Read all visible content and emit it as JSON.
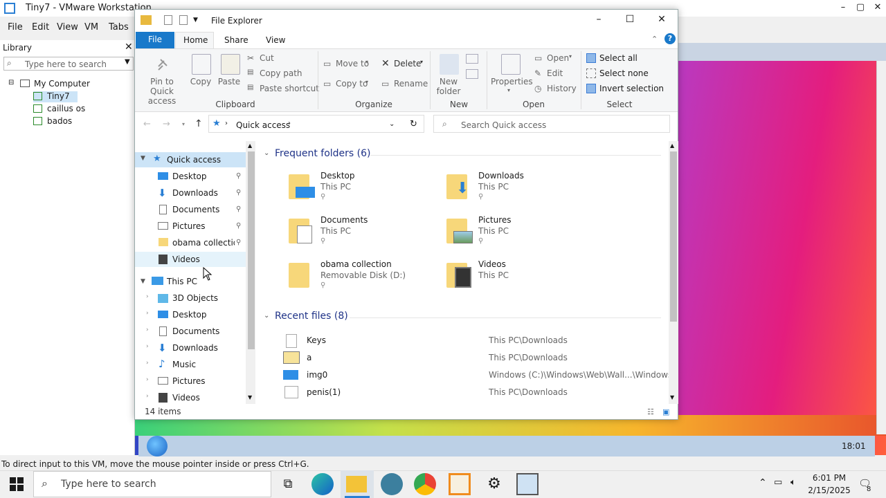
{
  "vmware": {
    "title": "Tiny7 - VMware Workstation",
    "menus": [
      "File",
      "Edit",
      "View",
      "VM",
      "Tabs"
    ],
    "library": {
      "title": "Library",
      "search_placeholder": "Type here to search",
      "tree": [
        "My Computer",
        "Tiny7",
        "caillus os",
        "bados"
      ]
    },
    "status_text": "To direct input to this VM, move the mouse pointer inside or press Ctrl+G.",
    "guest_clock": "18:01"
  },
  "explorer": {
    "title": "File Explorer",
    "tabs": [
      "File",
      "Home",
      "Share",
      "View"
    ],
    "ribbon": {
      "clipboard": {
        "group": "Clipboard",
        "pin": "Pin to Quick access",
        "copy": "Copy",
        "paste": "Paste",
        "cut": "Cut",
        "copy_path": "Copy path",
        "paste_shortcut": "Paste shortcut"
      },
      "organize": {
        "group": "Organize",
        "move_to": "Move to",
        "copy_to": "Copy to",
        "delete": "Delete",
        "rename": "Rename"
      },
      "new": {
        "group": "New",
        "new_folder": "New folder"
      },
      "open": {
        "group": "Open",
        "properties": "Properties",
        "open": "Open",
        "edit": "Edit",
        "history": "History"
      },
      "select": {
        "group": "Select",
        "select_all": "Select all",
        "select_none": "Select none",
        "invert": "Invert selection"
      }
    },
    "address_path": "Quick access",
    "search_placeholder": "Search Quick access",
    "nav": {
      "quick_access": "Quick access",
      "qa_items": [
        "Desktop",
        "Downloads",
        "Documents",
        "Pictures",
        "obama collection",
        "Videos"
      ],
      "this_pc": "This PC",
      "pc_items": [
        "3D Objects",
        "Desktop",
        "Documents",
        "Downloads",
        "Music",
        "Pictures",
        "Videos"
      ]
    },
    "frequent_title": "Frequent folders (6)",
    "frequent": [
      {
        "name": "Desktop",
        "sub": "This PC"
      },
      {
        "name": "Downloads",
        "sub": "This PC"
      },
      {
        "name": "Documents",
        "sub": "This PC"
      },
      {
        "name": "Pictures",
        "sub": "This PC"
      },
      {
        "name": "obama collection",
        "sub": "Removable Disk (D:)"
      },
      {
        "name": "Videos",
        "sub": "This PC"
      }
    ],
    "recent_title": "Recent files (8)",
    "recent": [
      {
        "name": "Keys",
        "path": "This PC\\Downloads"
      },
      {
        "name": "a",
        "path": "This PC\\Downloads"
      },
      {
        "name": "img0",
        "path": "Windows (C:)\\Windows\\Web\\Wall...\\Windows"
      },
      {
        "name": "penis(1)",
        "path": "This PC\\Downloads"
      }
    ],
    "status": "14 items"
  },
  "host": {
    "search_placeholder": "Type here to search",
    "time": "6:01 PM",
    "date": "2/15/2025",
    "notif_count": "8"
  }
}
